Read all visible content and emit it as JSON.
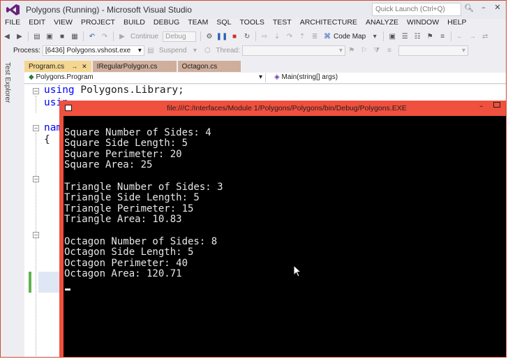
{
  "window": {
    "title": "Polygons (Running) - Microsoft Visual Studio",
    "quick_launch_placeholder": "Quick Launch (Ctrl+Q)"
  },
  "menu": [
    "FILE",
    "EDIT",
    "VIEW",
    "PROJECT",
    "BUILD",
    "DEBUG",
    "TEAM",
    "SQL",
    "TOOLS",
    "TEST",
    "ARCHITECTURE",
    "ANALYZE",
    "WINDOW",
    "HELP"
  ],
  "toolbar": {
    "continue_label": "Continue",
    "config_value": "Debug",
    "code_map_label": "Code Map"
  },
  "process_bar": {
    "process_label": "Process:",
    "process_value": "[6436] Polygons.vshost.exe",
    "suspend_label": "Suspend",
    "thread_label": "Thread:"
  },
  "side_panel": {
    "label": "Test Explorer"
  },
  "tabs": [
    {
      "label": "Program.cs",
      "active": true
    },
    {
      "label": "IRegularPolygon.cs",
      "active": false
    },
    {
      "label": "Octagon.cs",
      "active": false
    }
  ],
  "nav": {
    "type_value": "Polygons.Program",
    "member_value": "Main(string[] args)"
  },
  "code": {
    "line1_kw": "using",
    "line1_rest": " Polygons.Library;",
    "line2_kw": "usin",
    "line3_kw": "name",
    "line4": "{"
  },
  "console": {
    "title": "file:///C:/Interfaces/Module 1/Polygons/Polygons/bin/Debug/Polygons.EXE",
    "lines": [
      "Square Number of Sides: 4",
      "Square Side Length: 5",
      "Square Perimeter: 20",
      "Square Area: 25",
      "",
      "Triangle Number of Sides: 3",
      "Triangle Side Length: 5",
      "Triangle Perimeter: 15",
      "Triangle Area: 10.83",
      "",
      "Octagon Number of Sides: 8",
      "Octagon Side Length: 5",
      "Octagon Perimeter: 40",
      "Octagon Area: 120.71"
    ]
  },
  "colors": {
    "console_accent": "#f0503e",
    "keyword": "#0000ff",
    "active_tab": "#f4d690"
  }
}
